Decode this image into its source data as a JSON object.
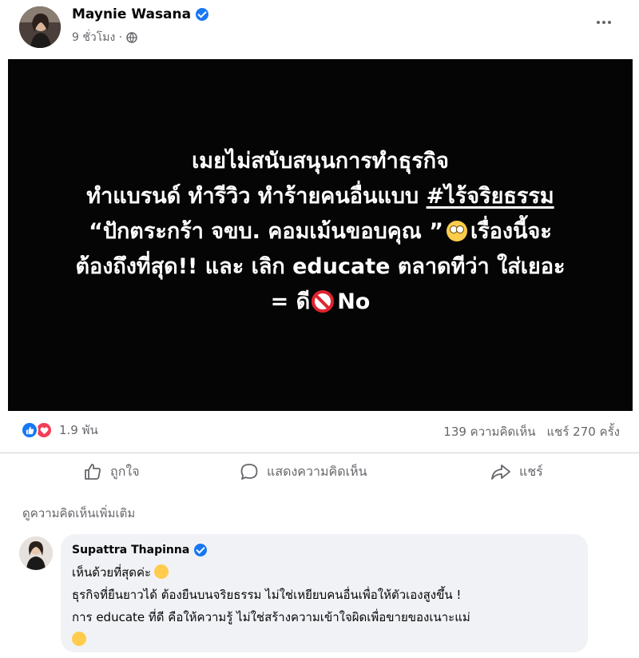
{
  "post": {
    "author": "Maynie Wasana",
    "time": "9 ชั่วโมง ·",
    "image_lines": [
      "เมยไม่สนับสนุนการทำธุรกิจ",
      "ทำแบรนด์ ทำรีวิว ทำร้ายคนอื่นแบบ",
      "#ไร้จริยธรรม",
      "“ปักตระกร้า จขบ. คอมเม้นขอบคุณ ”",
      "เรื่องนี้จะ",
      "ต้องถึงที่สุด!! และ เลิก educate ตลาดทีว่า ใส่เยอะ",
      "= ดี",
      "No"
    ]
  },
  "stats": {
    "reactions": "1.9 พัน",
    "comments": "139 ความคิดเห็น",
    "shares": "แชร์ 270 ครั้ง"
  },
  "actions": {
    "like": "ถูกใจ",
    "comment": "แสดงความคิดเห็น",
    "share": "แชร์"
  },
  "see_more": "ดูความคิดเห็นเพิ่มเติม",
  "comment": {
    "author": "Supattra Thapinna",
    "lines": [
      "เห็นด้วยที่สุดค่ะ",
      "ธุรกิจที่ยืนยาวได้ ต้องยืนบนจริยธรรม ไม่ใช่เหยียบคนอื่นเพื่อให้ตัวเองสูงขึ้น !",
      "การ educate ที่ดี คือให้ความรู้ ไม่ใช่สร้างความเข้าใจผิดเพื่อขายของเนาะแม่"
    ]
  },
  "colors": {
    "accent": "#1877f2",
    "love": "#f33e58",
    "muted": "#65676b",
    "bubble": "#f0f2f5"
  },
  "icons": [
    "verified-badge-icon",
    "globe-icon",
    "more-options-icon",
    "like-reaction-icon",
    "love-reaction-icon",
    "thumbs-up-icon",
    "comment-icon",
    "share-icon",
    "eye-roll-emoji",
    "prohibited-emoji",
    "clap-emoji",
    "sad-emoji"
  ]
}
